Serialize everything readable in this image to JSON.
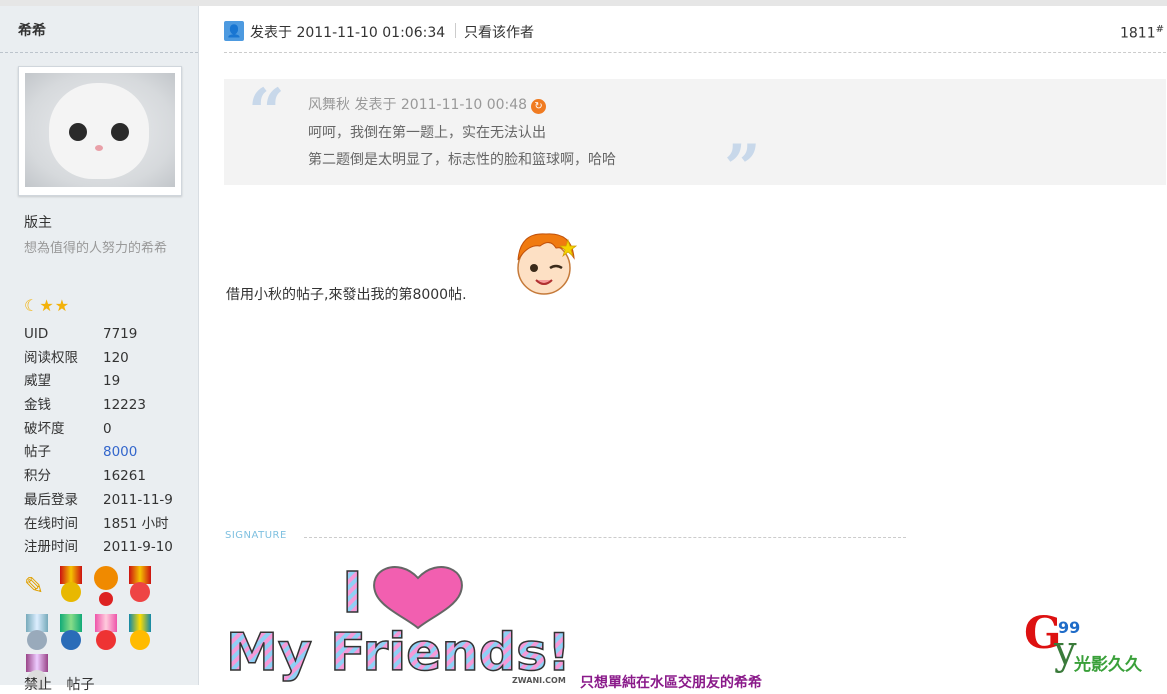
{
  "author": {
    "name": "希希",
    "role": "版主",
    "motto": "想為值得的人努力的希希",
    "stats": [
      {
        "label": "UID",
        "value": "7719"
      },
      {
        "label": "阅读权限",
        "value": "120"
      },
      {
        "label": "威望",
        "value": "19"
      },
      {
        "label": "金钱",
        "value": "12223"
      },
      {
        "label": "破坏度",
        "value": "0"
      },
      {
        "label": "帖子",
        "value": "8000"
      },
      {
        "label": "积分",
        "value": "16261"
      },
      {
        "label": "最后登录",
        "value": "2011-11-9"
      },
      {
        "label": "在线时间",
        "value": "1851 小时"
      },
      {
        "label": "注册时间",
        "value": "2011-9-10"
      }
    ],
    "footer_links": [
      "禁止",
      "帖子"
    ]
  },
  "post": {
    "posted_at": "发表于  2011-11-10 01:06:34",
    "only_author_label": "只看该作者",
    "floor": "1811",
    "floor_mark": "#",
    "quote": {
      "meta": "风舞秋  发表于  2011-11-10 00:48",
      "line1": "呵呵，我倒在第一题上，实在无法认出",
      "line2": "第二题倒是太明显了，标志性的脸和篮球啊，哈哈",
      "open_mark": "“",
      "close_mark": "”"
    },
    "body": "借用小秋的帖子,來發出我的第8000帖.",
    "signature_label": "SIGNATURE",
    "signature_text": "只想單純在水區交朋友的希希",
    "signature_art_text": "I ♥ My Friends!",
    "signature_credit": "ZWANI.COM"
  },
  "watermark": {
    "g": "G",
    "num": "99",
    "y": "y",
    "cn": "光影久久"
  },
  "colors": {
    "sidebar_bg": "#eaeef1",
    "link": "#3366cc",
    "quote_bg": "#f3f3f3",
    "signature_text": "#8a1a8a"
  }
}
